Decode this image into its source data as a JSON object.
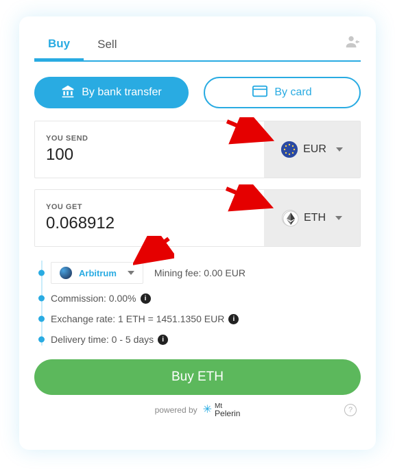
{
  "tabs": {
    "buy": "Buy",
    "sell": "Sell"
  },
  "methods": {
    "bank": "By bank transfer",
    "card": "By card"
  },
  "send": {
    "label": "YOU SEND",
    "value": "100",
    "currency": "EUR"
  },
  "get": {
    "label": "YOU GET",
    "value": "0.068912",
    "currency": "ETH"
  },
  "network": {
    "name": "Arbitrum"
  },
  "fees": {
    "mining": "Mining fee: 0.00 EUR",
    "commission": "Commission: 0.00%",
    "rate": "Exchange rate: 1 ETH = 1451.1350 EUR",
    "delivery": "Delivery time: 0 - 5 days"
  },
  "cta": "Buy ETH",
  "footer": {
    "powered": "powered by",
    "brand_top": "Mt",
    "brand_bottom": "Pelerin"
  }
}
